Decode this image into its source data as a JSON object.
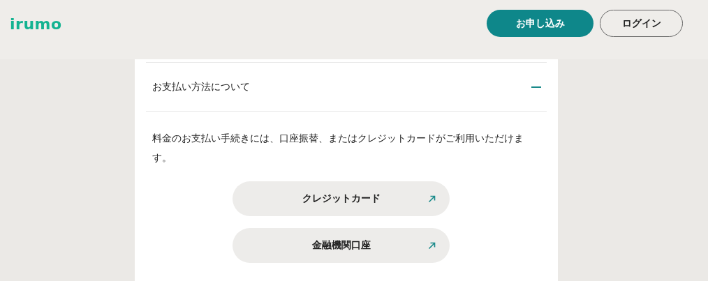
{
  "header": {
    "logo": "irumo",
    "buttons": [
      {
        "label": "お申し込み",
        "kind": "primary"
      },
      {
        "label": "ログイン",
        "kind": "outline"
      }
    ]
  },
  "accordion": {
    "title": "お支払い方法について",
    "expanded": true,
    "text": "料金のお支払い手続きには、口座振替、またはクレジットカードがご利用いただけます。",
    "links": [
      {
        "label": "クレジットカード"
      },
      {
        "label": "金融機関口座"
      }
    ]
  }
}
